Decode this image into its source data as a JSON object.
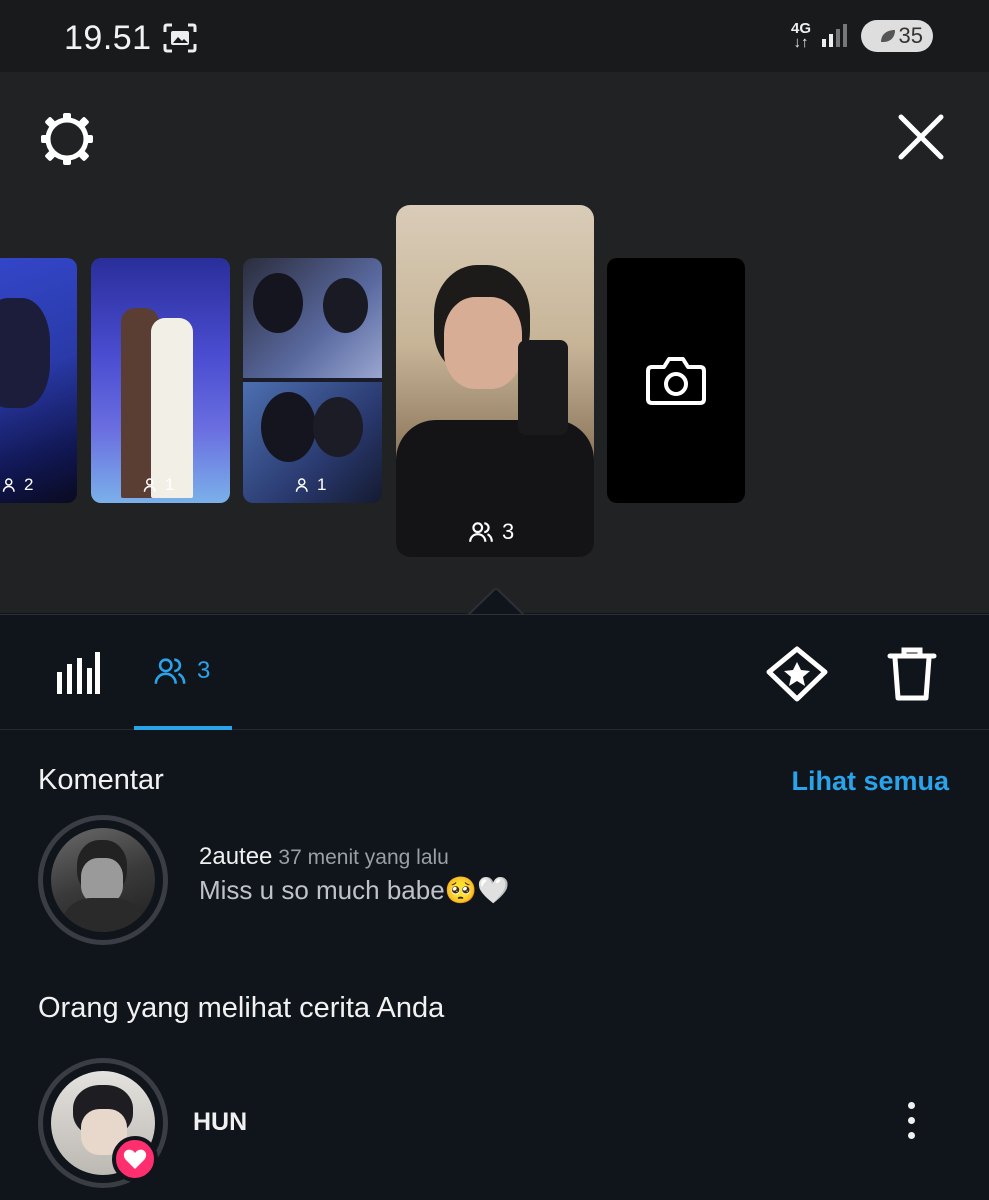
{
  "status_bar": {
    "time": "19.51",
    "network": "4G",
    "battery": "35"
  },
  "story_strip": {
    "items": [
      {
        "viewers": "2"
      },
      {
        "viewers": "1"
      },
      {
        "viewers": "1"
      },
      {
        "viewers": "3",
        "selected": true
      }
    ]
  },
  "tabs": {
    "viewers_count": "3"
  },
  "comments": {
    "title": "Komentar",
    "see_all": "Lihat semua",
    "items": [
      {
        "username": "2autee",
        "time": "37 menit yang lalu",
        "text": "Miss u so much babe🥺🤍"
      }
    ]
  },
  "viewers": {
    "title": "Orang yang melihat cerita Anda",
    "items": [
      {
        "name": "HUN",
        "liked": true
      }
    ]
  },
  "colors": {
    "accent": "#2aa3ea",
    "background": "#10141b",
    "like": "#ff2e6e"
  }
}
